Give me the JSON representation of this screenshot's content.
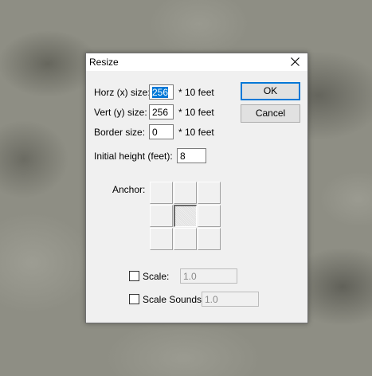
{
  "dialog": {
    "title": "Resize",
    "close_icon": "close-icon"
  },
  "fields": {
    "horz_label": "Horz (x) size:",
    "horz_value": "256",
    "horz_unit": "* 10 feet",
    "vert_label": "Vert (y) size:",
    "vert_value": "256",
    "vert_unit": "* 10 feet",
    "border_label": "Border size:",
    "border_value": "0",
    "border_unit": "* 10 feet",
    "height_label": "Initial height (feet):",
    "height_value": "8"
  },
  "buttons": {
    "ok": "OK",
    "cancel": "Cancel"
  },
  "anchor": {
    "label": "Anchor:",
    "selected": "center"
  },
  "scale": {
    "label": "Scale:",
    "value": "1.0",
    "checked": false
  },
  "scale_sounds": {
    "label": "Scale Sounds",
    "value": "1.0",
    "checked": false
  }
}
